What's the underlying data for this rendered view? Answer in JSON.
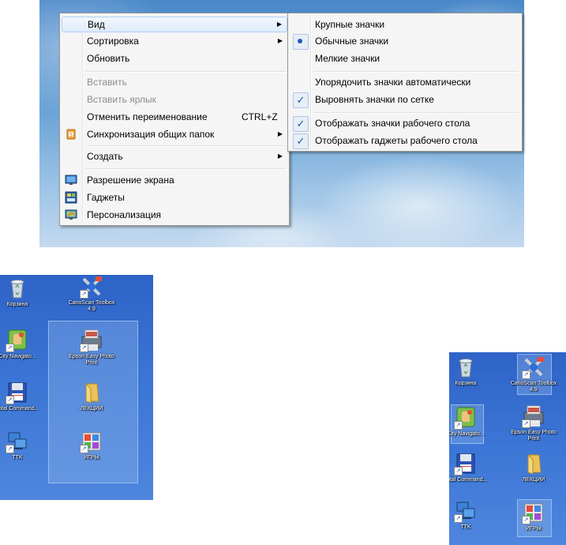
{
  "context_menu": {
    "items": [
      {
        "label": "Вид",
        "submenu": true,
        "highlighted": true
      },
      {
        "label": "Сортировка",
        "submenu": true
      },
      {
        "label": "Обновить"
      },
      {
        "label": "Вставить",
        "disabled": true
      },
      {
        "label": "Вставить ярлык",
        "disabled": true
      },
      {
        "label": "Отменить переименование",
        "shortcut": "CTRL+Z"
      },
      {
        "label": "Синхронизация общих папок",
        "submenu": true,
        "icon": "sync-folders-icon"
      },
      {
        "label": "Создать",
        "submenu": true
      },
      {
        "label": "Разрешение экрана",
        "icon": "screen-resolution-icon"
      },
      {
        "label": "Гаджеты",
        "icon": "gadgets-icon"
      },
      {
        "label": "Персонализация",
        "icon": "personalization-icon"
      }
    ]
  },
  "view_submenu": {
    "items": [
      {
        "label": "Крупные значки"
      },
      {
        "label": "Обычные значки",
        "radio_selected": true
      },
      {
        "label": "Мелкие значки"
      },
      {
        "label": "Упорядочить значки автоматически"
      },
      {
        "label": "Выровнять значки по сетке",
        "checked": true
      },
      {
        "label": "Отображать значки рабочего стола",
        "checked": true
      },
      {
        "label": "Отображать гаджеты  рабочего стола",
        "checked": true
      }
    ]
  },
  "desktop_left": {
    "icons": [
      {
        "label": "Корзина",
        "icon": "recycle-bin-icon"
      },
      {
        "label": "CanoScan Toolbox 4.9",
        "icon": "canoscan-icon"
      },
      {
        "label": "City Navigato...",
        "icon": "city-navigator-icon"
      },
      {
        "label": "Epson Easy Photo Print",
        "icon": "epson-icon"
      },
      {
        "label": "Total Command...",
        "icon": "floppy-icon"
      },
      {
        "label": "ЛЕКЦИИ",
        "icon": "folder-icon"
      },
      {
        "label": "TTK",
        "icon": "network-icon"
      },
      {
        "label": "ИГРЫ",
        "icon": "games-icon"
      }
    ]
  },
  "desktop_right": {
    "icons": [
      {
        "label": "Корзина",
        "icon": "recycle-bin-icon"
      },
      {
        "label": "CanoScan Toolbox 4.9",
        "icon": "canoscan-icon"
      },
      {
        "label": "City Navigato...",
        "icon": "city-navigator-icon"
      },
      {
        "label": "Epson Easy Photo Print",
        "icon": "epson-icon"
      },
      {
        "label": "Total Command...",
        "icon": "floppy-icon"
      },
      {
        "label": "ЛЕКЦИИ",
        "icon": "folder-icon"
      },
      {
        "label": "TTK",
        "icon": "network-icon"
      },
      {
        "label": "ИГРЫ",
        "icon": "games-icon"
      }
    ]
  }
}
